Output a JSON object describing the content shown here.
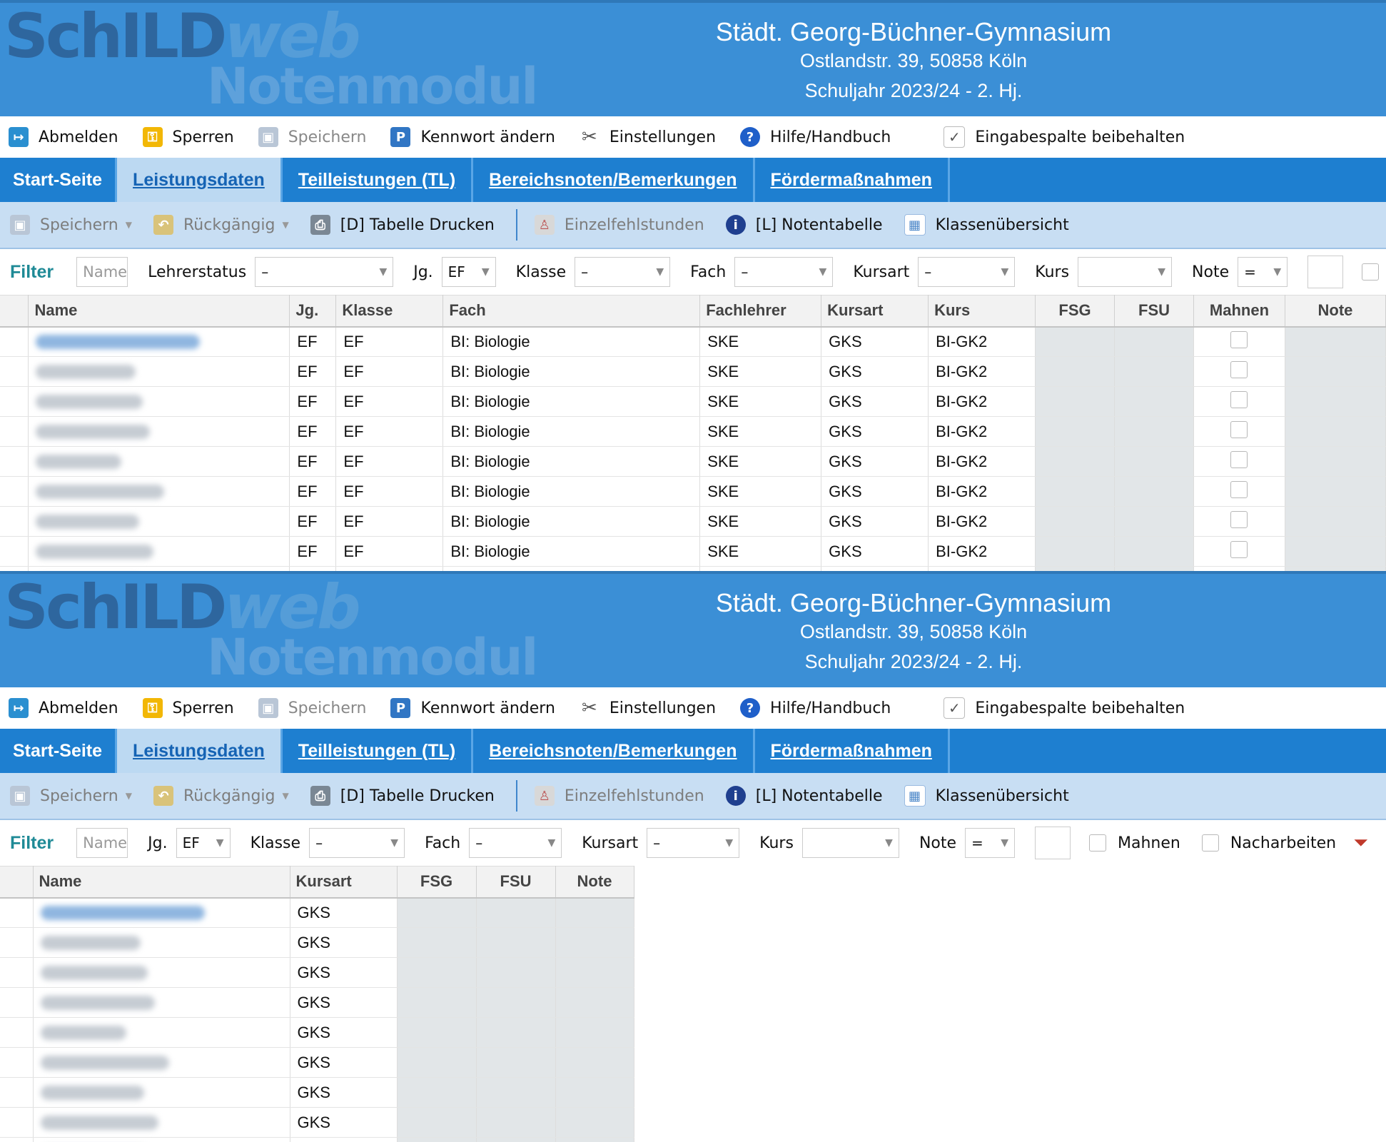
{
  "logo": {
    "part1": "SchILD",
    "part2": "web",
    "part3": "Notenmodul"
  },
  "school": {
    "name": "Städt. Georg-Büchner-Gymnasium",
    "address": "Ostlandstr. 39, 50858 Köln",
    "year": "Schuljahr 2023/24 - 2. Hj."
  },
  "menu": {
    "logout": "Abmelden",
    "lock": "Sperren",
    "save": "Speichern",
    "password": "Kennwort ändern",
    "settings": "Einstellungen",
    "help": "Hilfe/Handbuch",
    "keep_column": "Eingabespalte beibehalten"
  },
  "tabs": [
    "Start-Seite",
    "Leistungsdaten",
    "Teilleistungen (TL)",
    "Bereichsnoten/Bemerkungen",
    "Fördermaßnahmen"
  ],
  "toolbar": {
    "save": "Speichern",
    "undo": "Rückgängig",
    "print": "[D] Tabelle Drucken",
    "absence": "Einzelfehlstunden",
    "grade_table": "[L] Notentabelle",
    "class_overview": "Klassenübersicht"
  },
  "filter": {
    "label": "Filter",
    "name_placeholder": "Name",
    "lehrerstatus": "Lehrerstatus",
    "jg": "Jg.",
    "jg_value": "EF",
    "klasse": "Klasse",
    "fach": "Fach",
    "kursart": "Kursart",
    "kurs": "Kurs",
    "note": "Note",
    "note_op": "=",
    "dash": "–",
    "mahnen": "Mahnen",
    "nacharbeiten": "Nacharbeiten"
  },
  "grid1": {
    "columns": [
      "Name",
      "Jg.",
      "Klasse",
      "Fach",
      "Fachlehrer",
      "Kursart",
      "Kurs",
      "FSG",
      "FSU",
      "Mahnen",
      "Note"
    ],
    "row": {
      "jg": "EF",
      "klasse": "EF",
      "fach": "BI: Biologie",
      "lehrer": "SKE",
      "kursart": "GKS",
      "kurs": "BI-GK2"
    }
  },
  "grid2": {
    "columns": [
      "Name",
      "Kursart",
      "FSG",
      "FSU",
      "Note"
    ],
    "row": {
      "kursart": "GKS"
    }
  }
}
